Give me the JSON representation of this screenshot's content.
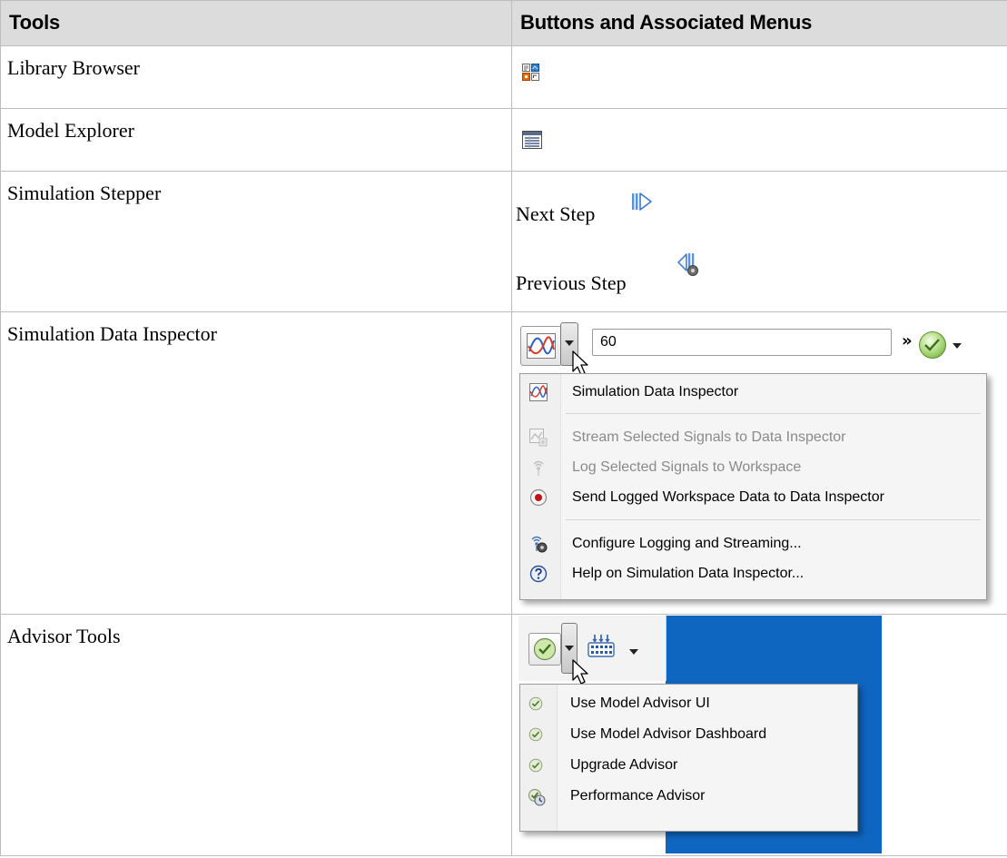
{
  "table": {
    "headers": [
      "Tools",
      "Buttons and Associated Menus"
    ],
    "rows": [
      {
        "tool": "Library Browser",
        "icon": "library-browser-icon"
      },
      {
        "tool": "Model Explorer",
        "icon": "model-explorer-icon"
      },
      {
        "tool": "Simulation Stepper",
        "next_label": "Next Step",
        "next_icon": "step-forward-icon",
        "prev_label": "Previous Step",
        "prev_icon": "step-back-icon"
      },
      {
        "tool": "Simulation Data Inspector"
      },
      {
        "tool": "Advisor Tools"
      }
    ]
  },
  "sdi": {
    "stop_time": "60",
    "more_glyph": "»",
    "menu": [
      {
        "label": "Simulation Data Inspector",
        "icon": "sdi-icon",
        "enabled": true
      },
      {
        "label": "Stream Selected Signals to Data Inspector",
        "icon": "stream-signals-icon",
        "enabled": false
      },
      {
        "label": "Log Selected Signals to Workspace",
        "icon": "log-signals-icon",
        "enabled": false
      },
      {
        "label": "Send Logged Workspace Data to Data Inspector",
        "icon": "record-icon",
        "enabled": true
      },
      {
        "label": "Configure Logging and Streaming...",
        "icon": "configure-logging-icon",
        "enabled": true
      },
      {
        "label": "Help on Simulation Data Inspector...",
        "icon": "help-icon",
        "enabled": true
      }
    ]
  },
  "advisor": {
    "menu": [
      {
        "label": "Use Model Advisor UI",
        "icon": "check-icon"
      },
      {
        "label": "Use Model Advisor Dashboard",
        "icon": "check-icon"
      },
      {
        "label": "Upgrade Advisor",
        "icon": "check-icon"
      },
      {
        "label": "Performance Advisor",
        "icon": "performance-advisor-icon"
      }
    ]
  },
  "colors": {
    "header_bg": "#dcdcdc",
    "border": "#bdbdbd",
    "advisor_bg": "#0f66c0",
    "record_red": "#c0121a"
  }
}
